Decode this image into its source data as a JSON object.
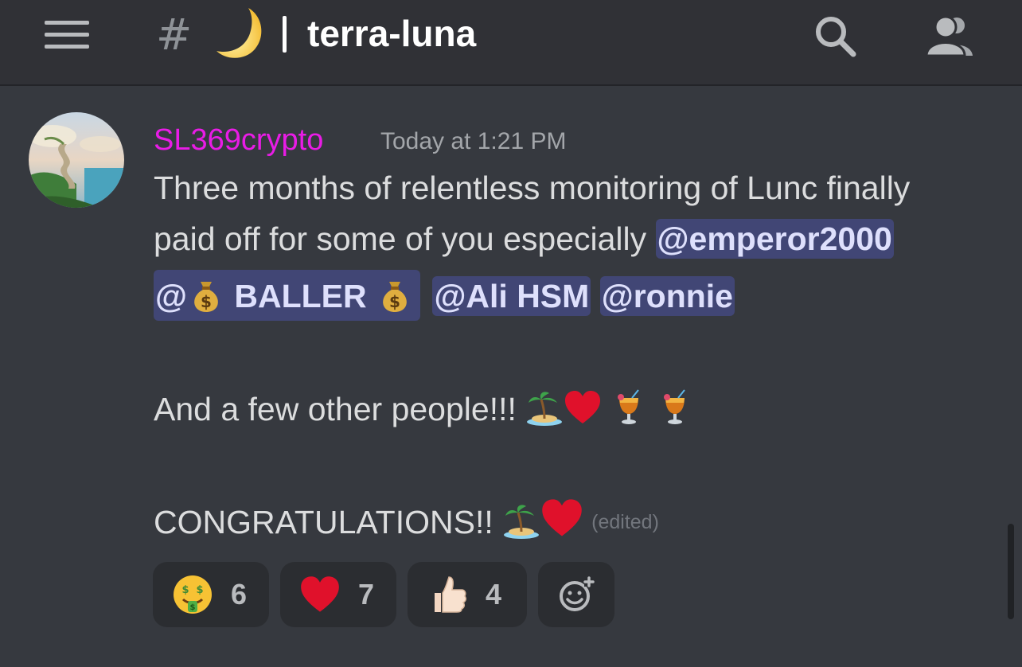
{
  "header": {
    "menu_icon": "hamburger-icon",
    "hash": "#",
    "channel_emoji": "🌙",
    "channel_name": "terra-luna",
    "search_icon": "search-icon",
    "members_icon": "members-icon"
  },
  "message": {
    "author": "SL369crypto",
    "author_color": "#e91ce6",
    "timestamp": "Today at 1:21 PM",
    "line1": "Three months of relentless monitoring of Lunc finally",
    "line2_text": "paid off for some of you especially ",
    "mentions": {
      "emperor": "@emperor2000",
      "baller_prefix": "@",
      "baller_name": " BALLER ",
      "ali": "@Ali HSM",
      "ronnie": "@ronnie"
    },
    "line3": "And a few other people!!! ",
    "line4": "CONGRATULATIONS!! ",
    "edited": "(edited)"
  },
  "reactions": [
    {
      "emoji": "money-mouth-face",
      "count": "6"
    },
    {
      "emoji": "red-heart",
      "count": "7"
    },
    {
      "emoji": "thumbs-up",
      "count": "4"
    },
    {
      "emoji": "add-reaction-icon",
      "count": ""
    }
  ],
  "colors": {
    "background": "#36393f",
    "topbar": "#303136",
    "mention_bg": "#414675",
    "mention_text": "#dee0fc"
  }
}
